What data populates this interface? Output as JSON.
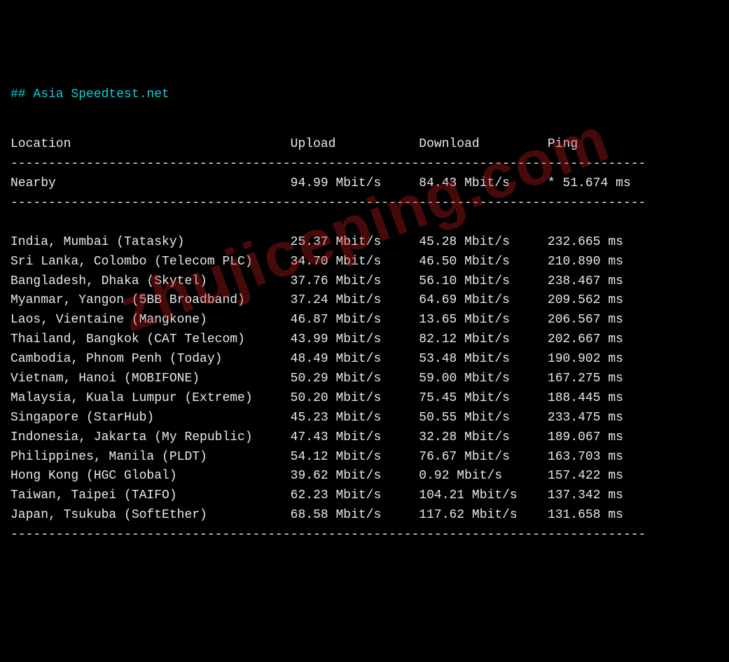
{
  "title": "## Asia Speedtest.net",
  "watermark": "zhujiceping.com",
  "headers": {
    "location": "Location",
    "upload": "Upload",
    "download": "Download",
    "ping": "Ping"
  },
  "nearby": {
    "location": "Nearby",
    "upload": "94.99 Mbit/s",
    "download": "84.43 Mbit/s",
    "ping": "* 51.674 ms"
  },
  "rows": [
    {
      "location": "India, Mumbai (Tatasky)",
      "upload": "25.37 Mbit/s",
      "download": "45.28 Mbit/s",
      "ping": "232.665 ms"
    },
    {
      "location": "Sri Lanka, Colombo (Telecom PLC)",
      "upload": "34.70 Mbit/s",
      "download": "46.50 Mbit/s",
      "ping": "210.890 ms"
    },
    {
      "location": "Bangladesh, Dhaka (Skytel)",
      "upload": "37.76 Mbit/s",
      "download": "56.10 Mbit/s",
      "ping": "238.467 ms"
    },
    {
      "location": "Myanmar, Yangon (5BB Broadband)",
      "upload": "37.24 Mbit/s",
      "download": "64.69 Mbit/s",
      "ping": "209.562 ms"
    },
    {
      "location": "Laos, Vientaine (Mangkone)",
      "upload": "46.87 Mbit/s",
      "download": "13.65 Mbit/s",
      "ping": "206.567 ms"
    },
    {
      "location": "Thailand, Bangkok (CAT Telecom)",
      "upload": "43.99 Mbit/s",
      "download": "82.12 Mbit/s",
      "ping": "202.667 ms"
    },
    {
      "location": "Cambodia, Phnom Penh (Today)",
      "upload": "48.49 Mbit/s",
      "download": "53.48 Mbit/s",
      "ping": "190.902 ms"
    },
    {
      "location": "Vietnam, Hanoi (MOBIFONE)",
      "upload": "50.29 Mbit/s",
      "download": "59.00 Mbit/s",
      "ping": "167.275 ms"
    },
    {
      "location": "Malaysia, Kuala Lumpur (Extreme)",
      "upload": "50.20 Mbit/s",
      "download": "75.45 Mbit/s",
      "ping": "188.445 ms"
    },
    {
      "location": "Singapore (StarHub)",
      "upload": "45.23 Mbit/s",
      "download": "50.55 Mbit/s",
      "ping": "233.475 ms"
    },
    {
      "location": "Indonesia, Jakarta (My Republic)",
      "upload": "47.43 Mbit/s",
      "download": "32.28 Mbit/s",
      "ping": "189.067 ms"
    },
    {
      "location": "Philippines, Manila (PLDT)",
      "upload": "54.12 Mbit/s",
      "download": "76.67 Mbit/s",
      "ping": "163.703 ms"
    },
    {
      "location": "Hong Kong (HGC Global)",
      "upload": "39.62 Mbit/s",
      "download": "0.92 Mbit/s",
      "ping": "157.422 ms"
    },
    {
      "location": "Taiwan, Taipei (TAIFO)",
      "upload": "62.23 Mbit/s",
      "download": "104.21 Mbit/s",
      "ping": "137.342 ms"
    },
    {
      "location": "Japan, Tsukuba (SoftEther)",
      "upload": "68.58 Mbit/s",
      "download": "117.62 Mbit/s",
      "ping": "131.658 ms"
    }
  ],
  "cols": {
    "location": 37,
    "upload": 17,
    "download": 17,
    "ping": 13
  }
}
